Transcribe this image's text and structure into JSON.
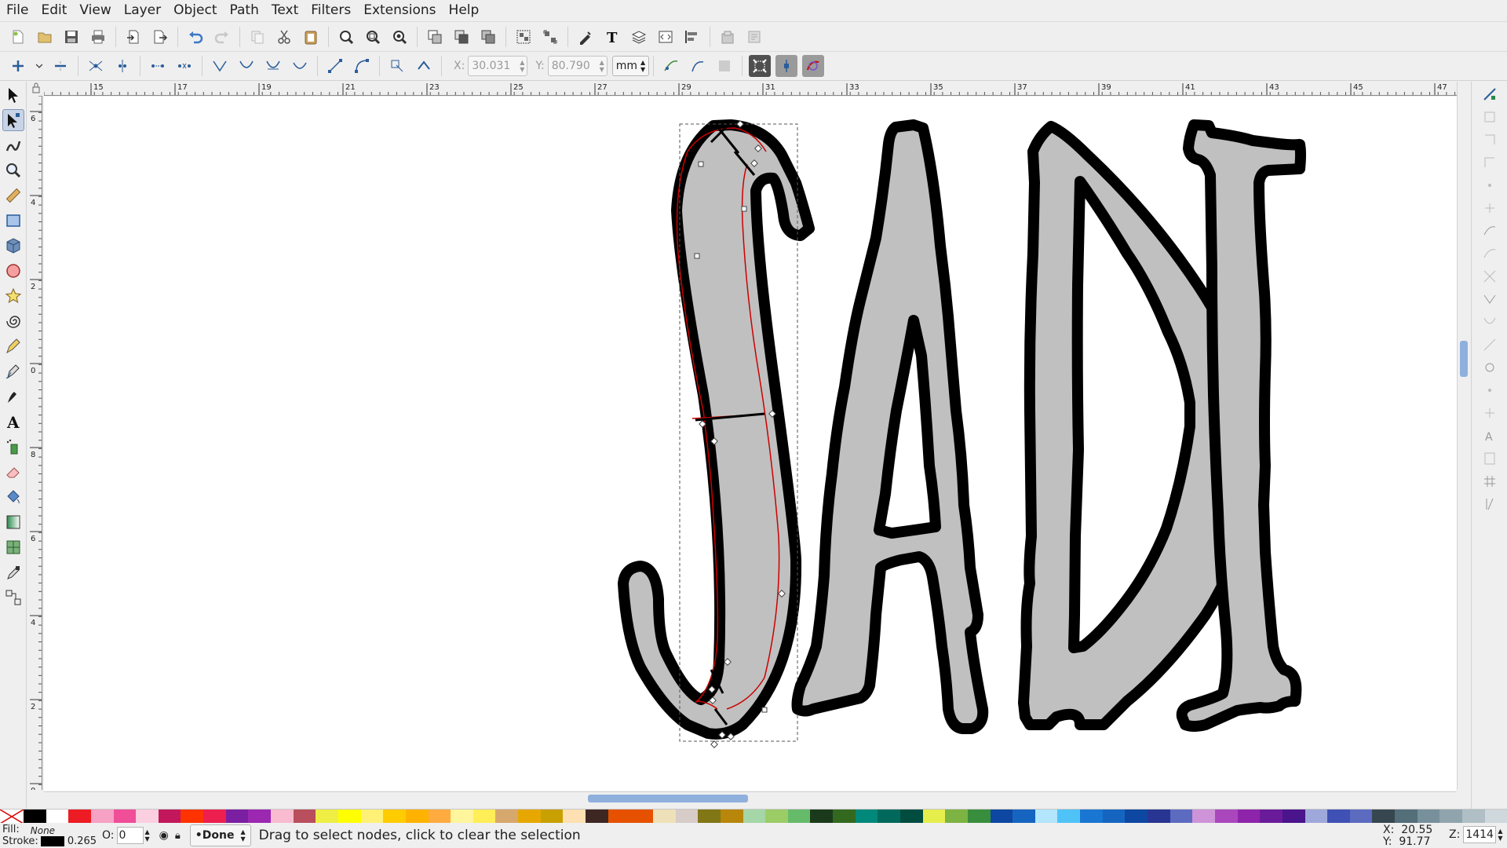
{
  "menu": [
    "File",
    "Edit",
    "View",
    "Layer",
    "Object",
    "Path",
    "Text",
    "Filters",
    "Extensions",
    "Help"
  ],
  "command_bar": {
    "icons": [
      "new-document-icon",
      "open-icon",
      "save-icon",
      "print-icon",
      "import-icon",
      "export-icon",
      "undo-icon",
      "redo-icon",
      "copy-icon",
      "cut-icon",
      "paste-icon",
      "zoom-selection-icon",
      "zoom-drawing-icon",
      "zoom-page-icon",
      "duplicate-icon",
      "clone-icon",
      "unlink-clone-icon",
      "group-icon",
      "ungroup-icon",
      "fill-stroke-icon",
      "text-font-icon",
      "layers-icon",
      "xml-editor-icon",
      "align-icon",
      "preferences-icon",
      "document-properties-icon"
    ]
  },
  "node_toolbar": {
    "x_label": "X:",
    "x_value": "30.031",
    "y_label": "Y:",
    "y_value": "80.790",
    "unit": "mm"
  },
  "tools": [
    "selector-tool",
    "node-tool",
    "tweak-tool",
    "zoom-tool",
    "measure-tool",
    "rectangle-tool",
    "3d-box-tool",
    "ellipse-tool",
    "star-tool",
    "spiral-tool",
    "pencil-tool",
    "pen-tool",
    "calligraphy-tool",
    "text-tool",
    "spray-tool",
    "eraser-tool",
    "bucket-tool",
    "gradient-tool",
    "mesh-tool",
    "dropper-tool",
    "connector-tool"
  ],
  "ruler": {
    "h_labels": [
      "15",
      "17",
      "19",
      "21",
      "23",
      "25",
      "27",
      "29",
      "31",
      "33",
      "35",
      "37",
      "39",
      "41",
      "43",
      "45",
      "47"
    ],
    "v_labels": [
      "6",
      "4",
      "2",
      "0",
      "8",
      "6",
      "4",
      "2",
      "0"
    ]
  },
  "colors": {
    "letter_fill": "#c0c0c0",
    "letter_stroke": "#000000",
    "path_highlight": "#cc0000"
  },
  "palette": [
    "#000000",
    "#ffffff",
    "#ed1c24",
    "#f7a1c4",
    "#f04e98",
    "#fbcfe0",
    "#c2185b",
    "#ff3300",
    "#ec1f4e",
    "#7b1fa2",
    "#9c27b0",
    "#f8bbd0",
    "#b94e5c",
    "#eeee44",
    "#ffff00",
    "#fff176",
    "#ffcc00",
    "#ffb300",
    "#ffab40",
    "#fff59d",
    "#ffee58",
    "#d7a86e",
    "#e6a800",
    "#c8a000",
    "#ffe0b2",
    "#3e2723",
    "#e65100",
    "#e65100",
    "#eee0b8",
    "#d7ccc8",
    "#827717",
    "#b8860b",
    "#a5d6a7",
    "#9ccc65",
    "#66bb6a",
    "#1b3a1b",
    "#33691e",
    "#00897b",
    "#00695c",
    "#004d40",
    "#e6ee4c",
    "#7cb342",
    "#388e3c",
    "#0d47a1",
    "#1565c0",
    "#b3e5fc",
    "#4fc3f7",
    "#1976d2",
    "#1565c0",
    "#0d47a1",
    "#283593",
    "#5c6bc0",
    "#ce93d8",
    "#ab47bc",
    "#8e24aa",
    "#6a1b9a",
    "#4a148c",
    "#9fa8da",
    "#3f51b5",
    "#5c6bc0",
    "#37474f",
    "#546e7a",
    "#78909c",
    "#90a4ae",
    "#b0bec5",
    "#cfd8dc"
  ],
  "status": {
    "fill_label": "Fill:",
    "fill_value": "None",
    "stroke_label": "Stroke:",
    "stroke_width": "0.265",
    "opacity_label": "O:",
    "opacity_value": "0",
    "layer": "•Done",
    "message": "Drag to select nodes, click to clear the selection",
    "cursor_x_label": "X:",
    "cursor_x": "20.55",
    "cursor_y_label": "Y:",
    "cursor_y": "91.77",
    "zoom_label": "Z:",
    "zoom_value": "1414"
  }
}
